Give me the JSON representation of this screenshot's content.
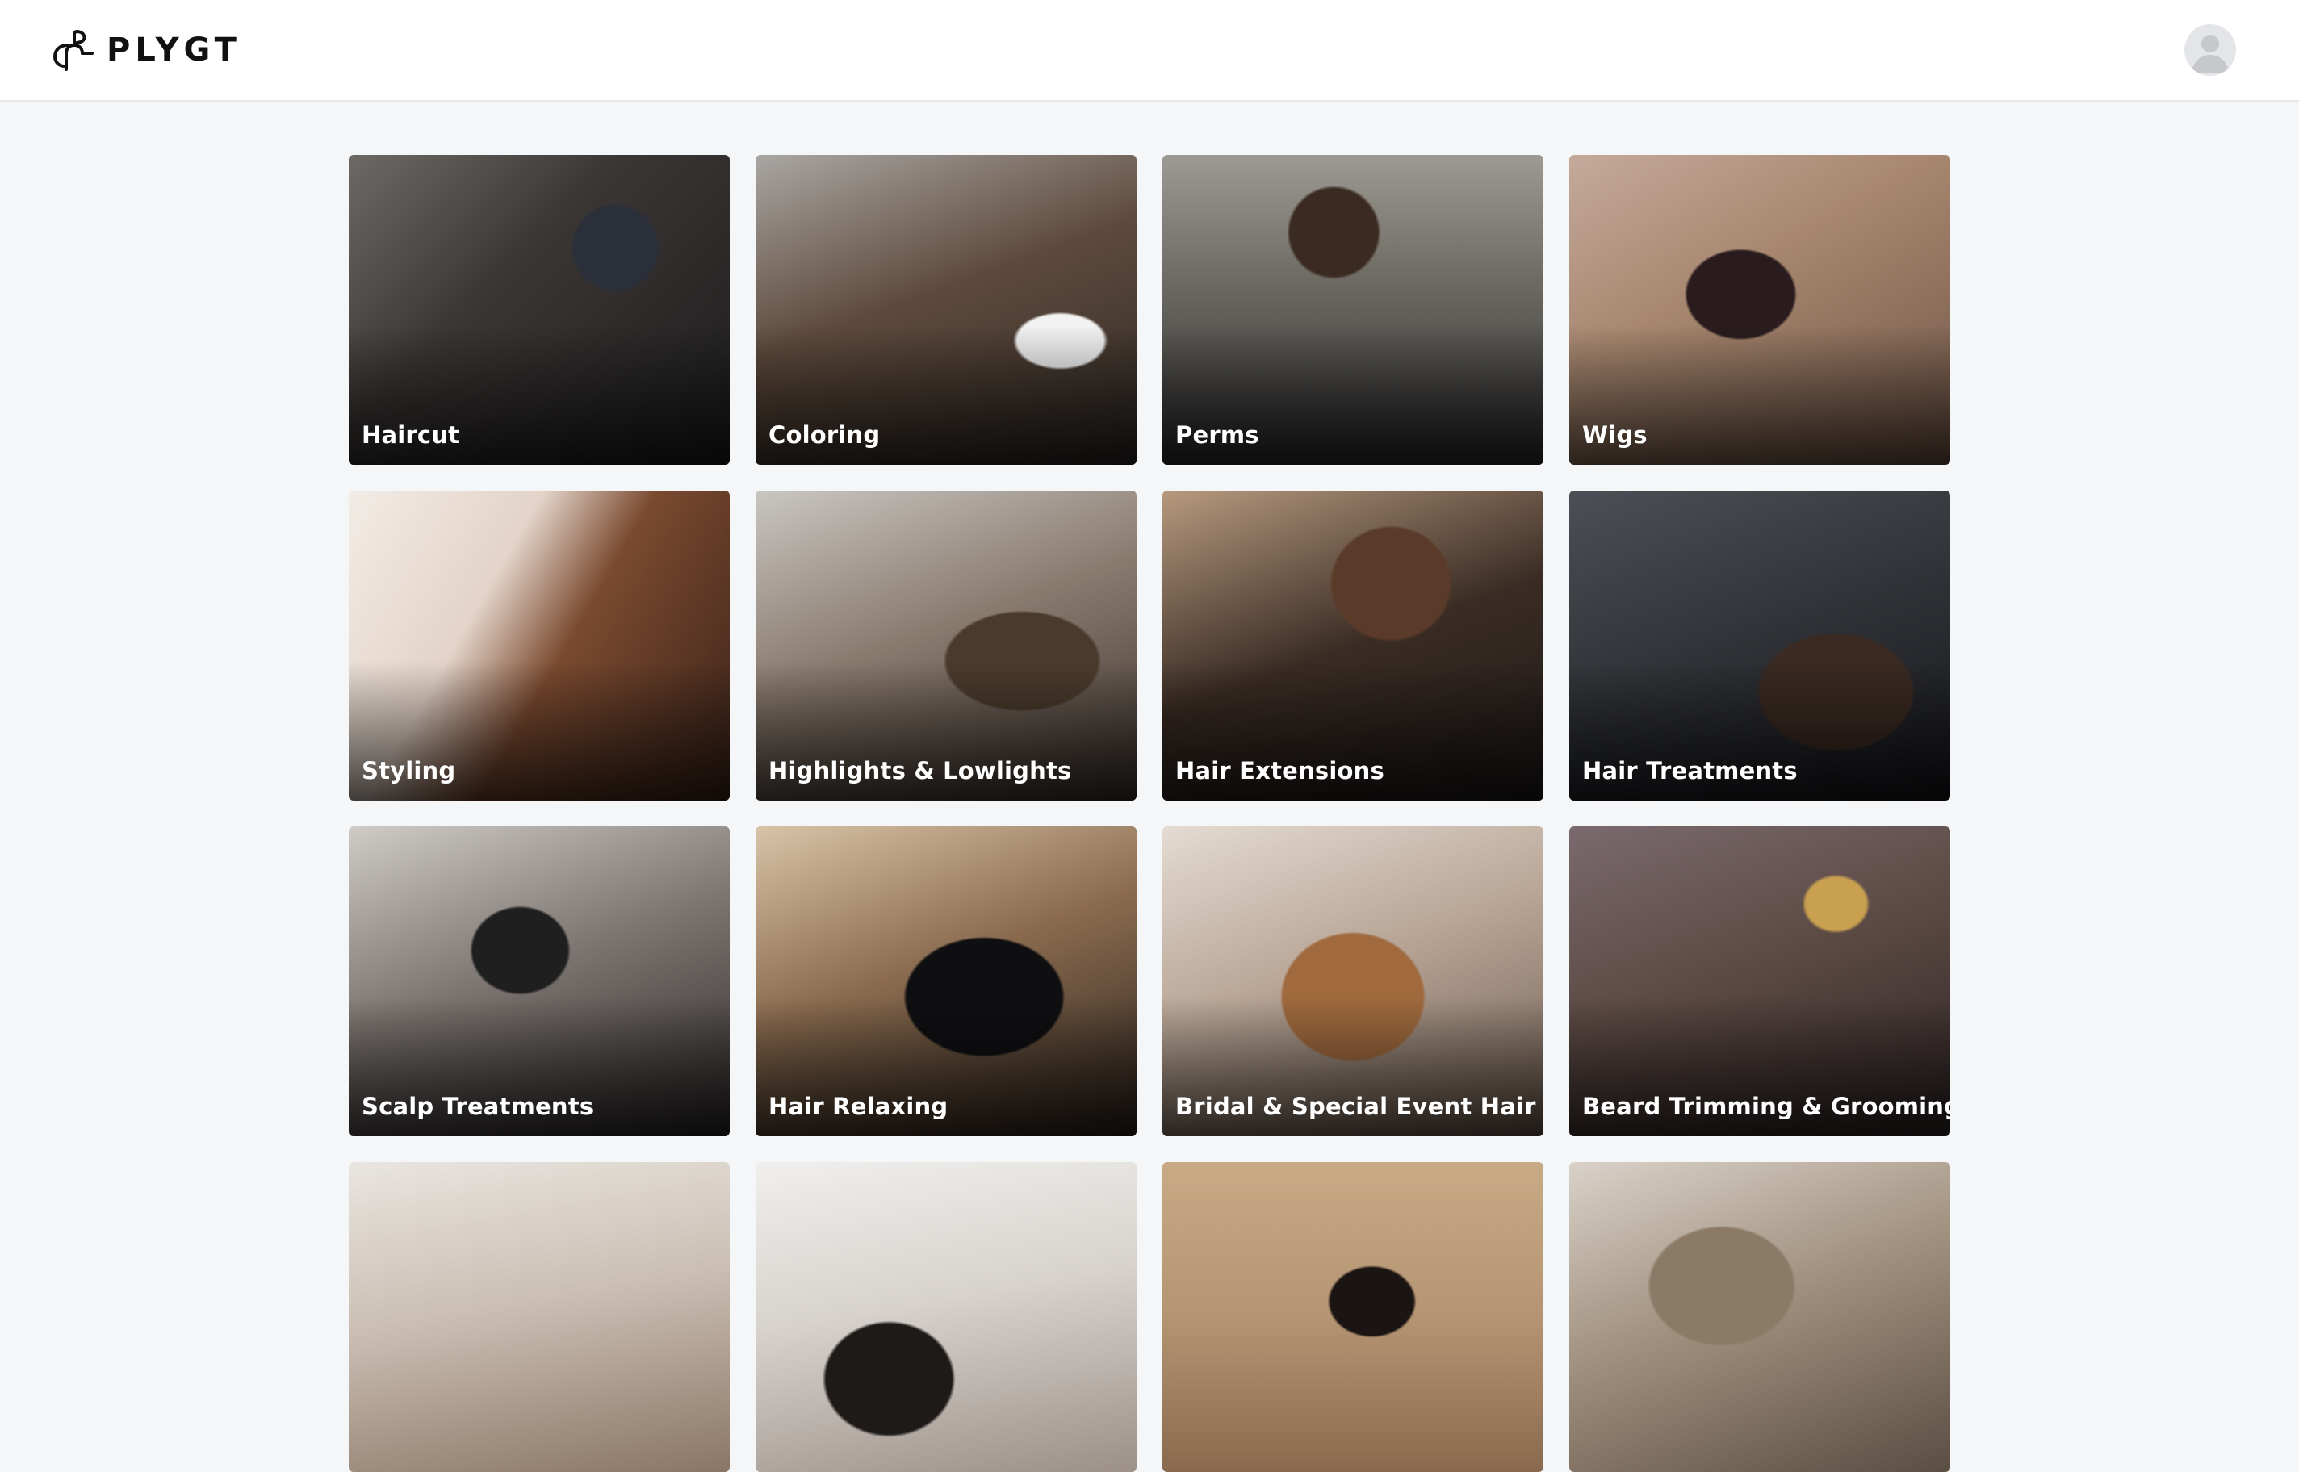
{
  "app": {
    "brand": "PLYGT"
  },
  "categories": [
    {
      "label": "Haircut"
    },
    {
      "label": "Coloring"
    },
    {
      "label": "Perms"
    },
    {
      "label": "Wigs"
    },
    {
      "label": "Styling"
    },
    {
      "label": "Highlights & Lowlights"
    },
    {
      "label": "Hair Extensions"
    },
    {
      "label": "Hair Treatments"
    },
    {
      "label": "Scalp Treatments"
    },
    {
      "label": "Hair Relaxing"
    },
    {
      "label": "Bridal & Special Event Hair"
    },
    {
      "label": "Beard Trimming & Grooming"
    },
    {
      "label": ""
    },
    {
      "label": ""
    },
    {
      "label": ""
    },
    {
      "label": ""
    }
  ]
}
